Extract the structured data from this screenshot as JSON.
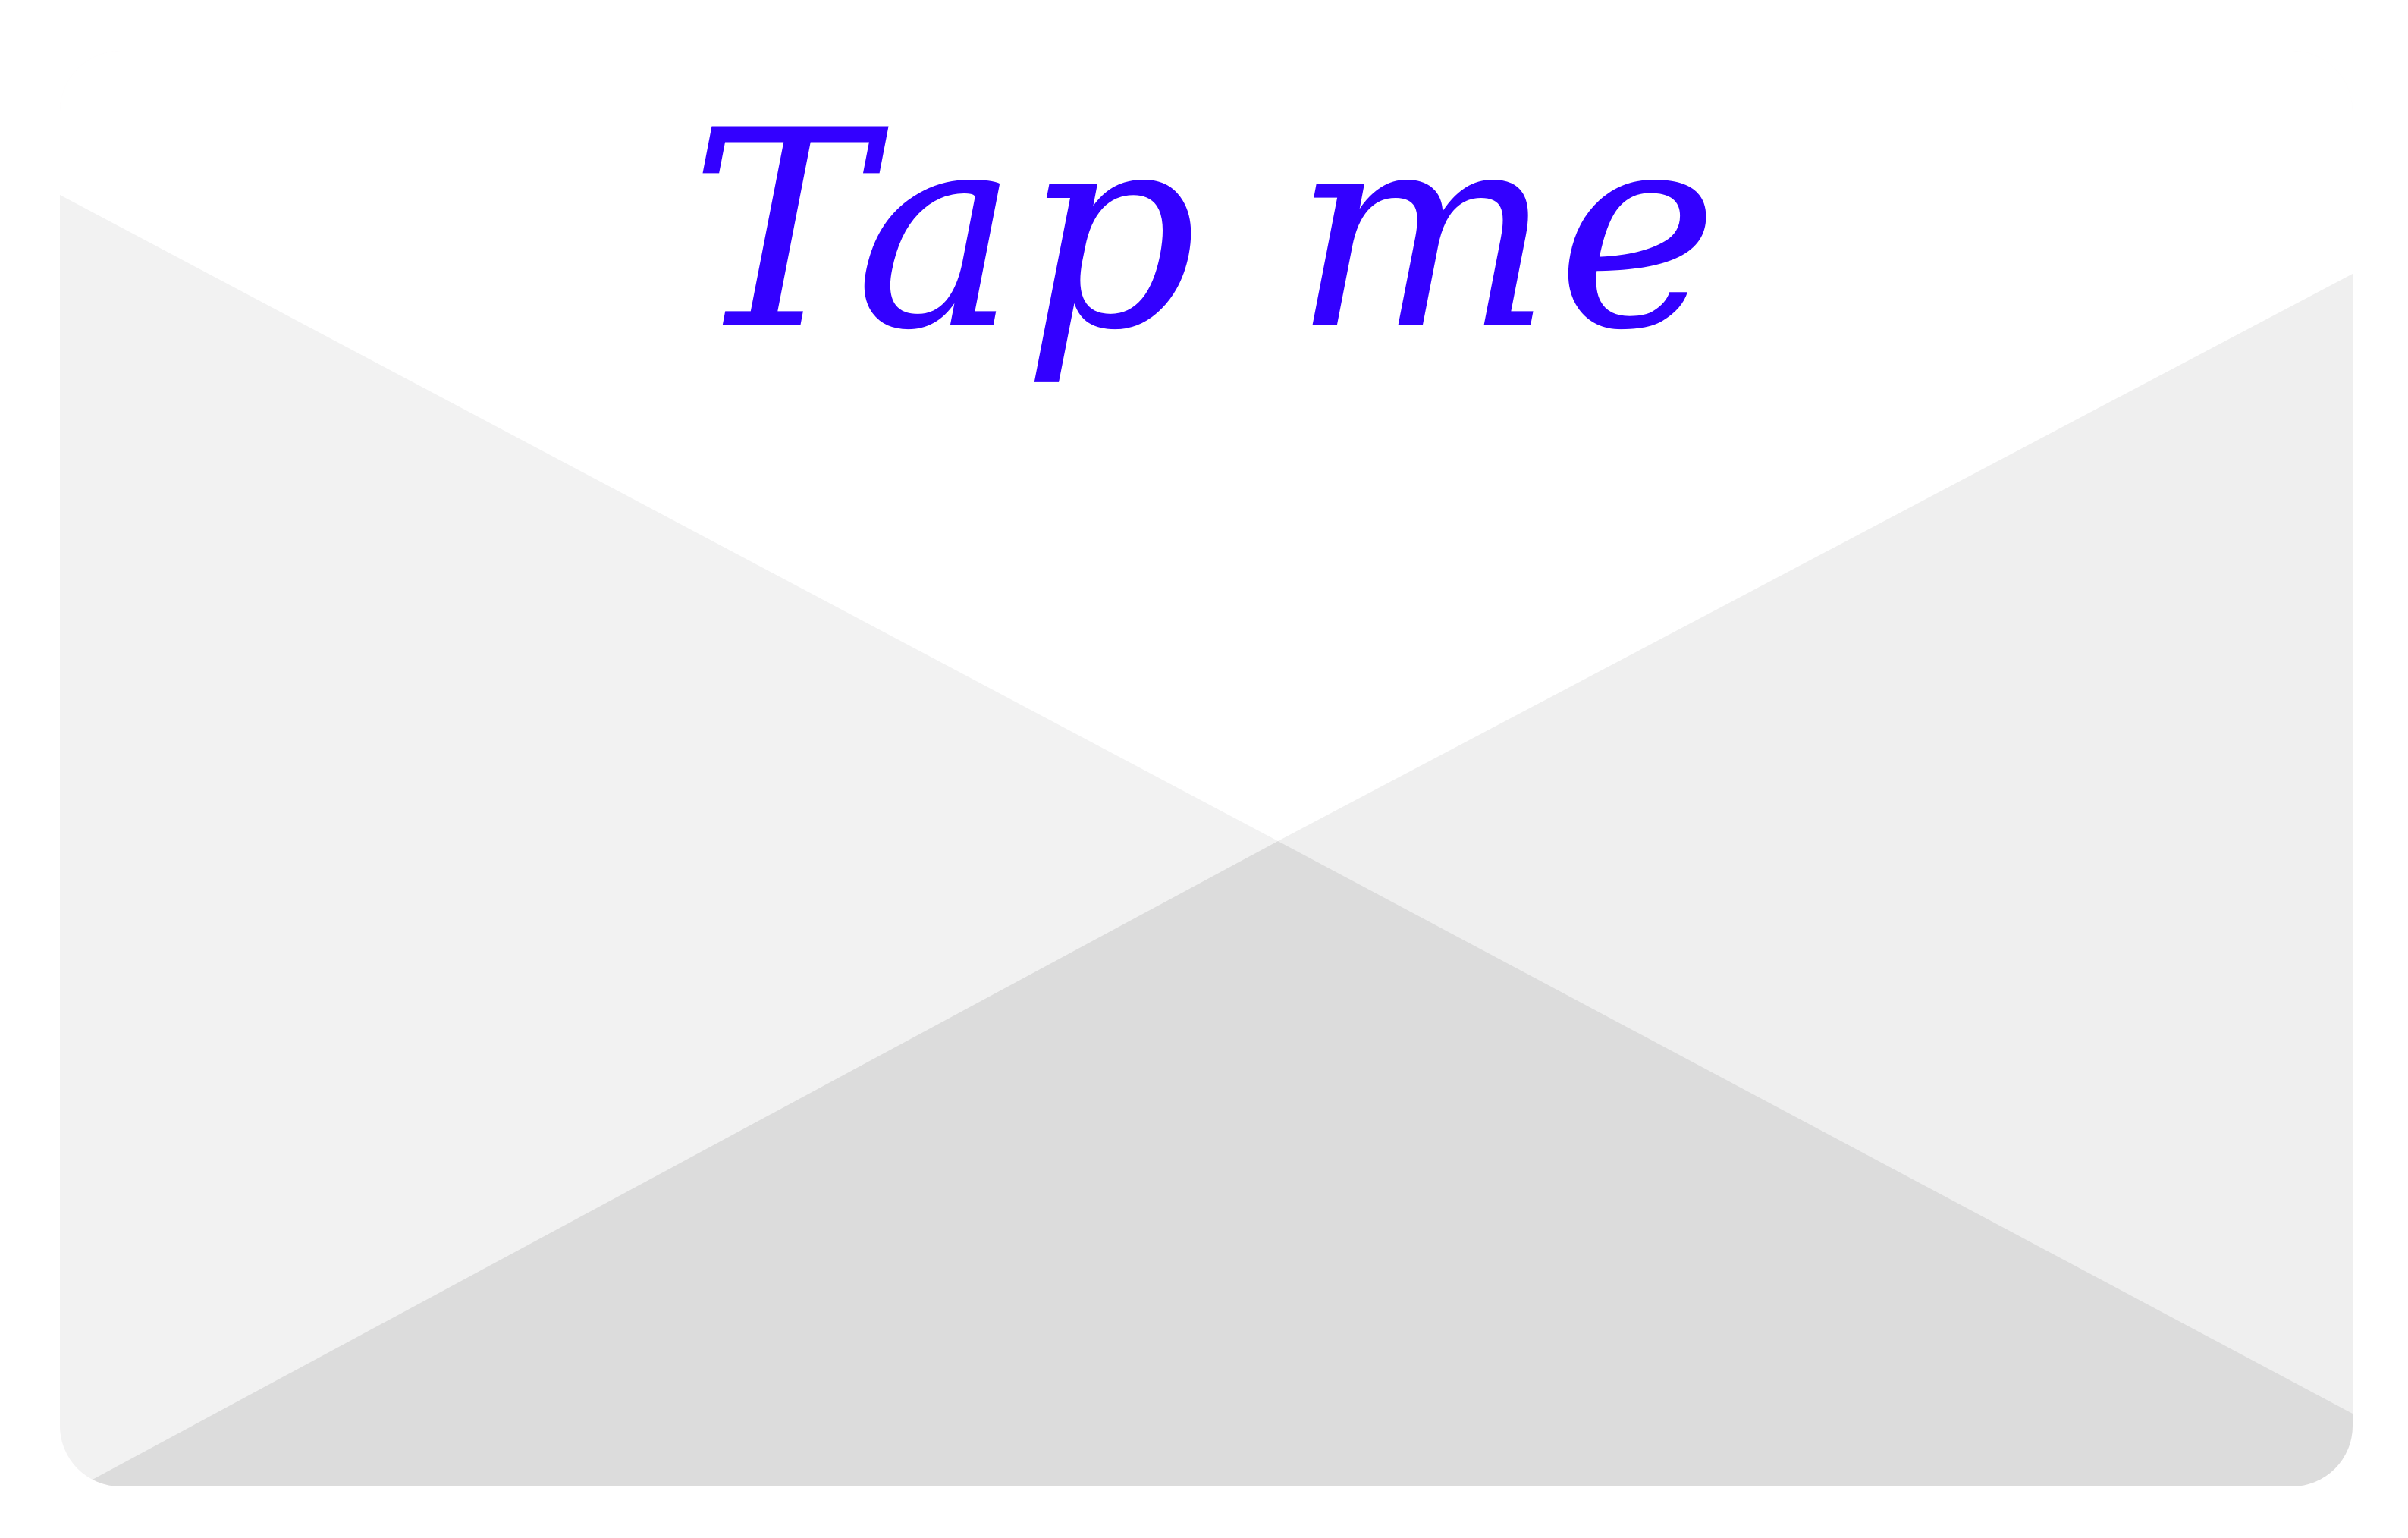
{
  "card": {
    "label": "Tap me"
  },
  "colors": {
    "label": "#3300ff",
    "flap_top": "#ffffff",
    "flap_left": "#f2f2f2",
    "flap_right": "#efefef",
    "flap_bottom": "#dcdcdc"
  },
  "icons": {
    "envelope": "envelope-icon"
  }
}
